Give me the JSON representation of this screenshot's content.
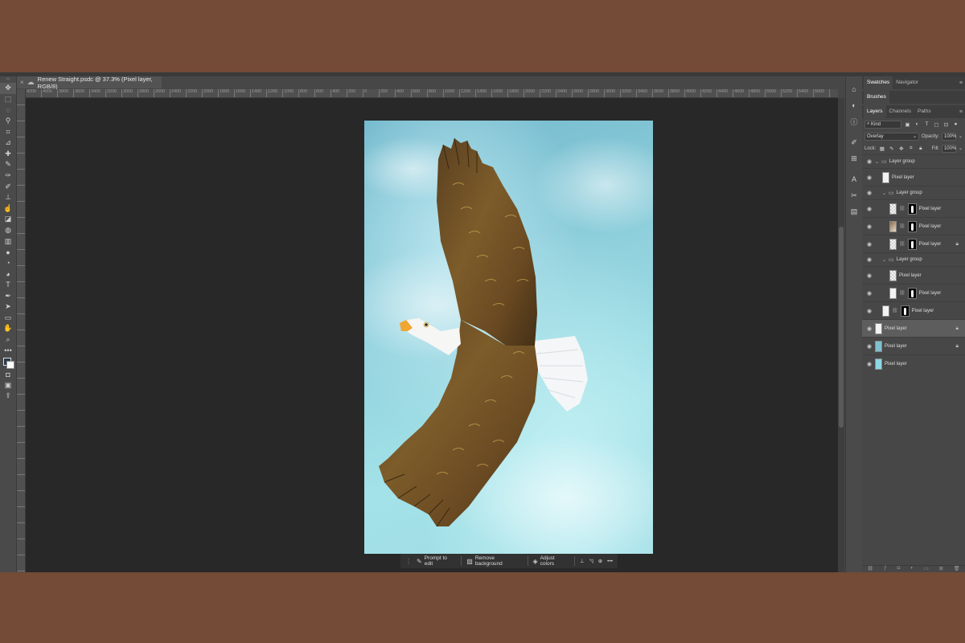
{
  "document": {
    "tab_title": "Renew Straight.psdc @ 37.3% (Pixel layer, RGB/8)"
  },
  "ruler": {
    "h_ticks": [
      "4200",
      "4000",
      "3800",
      "3600",
      "3400",
      "3200",
      "3000",
      "2800",
      "2600",
      "2400",
      "2200",
      "2000",
      "1800",
      "1600",
      "1400",
      "1200",
      "1000",
      "800",
      "600",
      "400",
      "200",
      "0",
      "200",
      "400",
      "600",
      "800",
      "1000",
      "1200",
      "1400",
      "1600",
      "1800",
      "2000",
      "2200",
      "2400",
      "2600",
      "2800",
      "3000",
      "3200",
      "3400",
      "3600",
      "3800",
      "4000",
      "4200",
      "4400",
      "4600",
      "4800",
      "5000",
      "5200",
      "5400",
      "5600"
    ]
  },
  "toolbar": {
    "tools": [
      "move-tool-icon",
      "marquee-tool-icon",
      "lasso-tool-icon",
      "object-select-tool-icon",
      "crop-tool-icon",
      "eyedropper-tool-icon",
      "spot-healing-tool-icon",
      "brush-tool-icon",
      "clone-stamp-tool-icon",
      "history-brush-tool-icon",
      "stamp-tool-icon",
      "smudge-tool-icon",
      "eraser-tool-icon",
      "paint-bucket-tool-icon",
      "gradient-tool-icon",
      "blur-tool-icon",
      "dodge-tool-icon",
      "sponge-tool-icon",
      "type-tool-icon",
      "pen-tool-icon",
      "path-select-tool-icon",
      "shape-tool-icon",
      "hand-tool-icon",
      "zoom-tool-icon",
      "more-tools-icon"
    ]
  },
  "contextual_taskbar": {
    "prompt": "Prompt to edit",
    "remove_bg": "Remove background",
    "adjust": "Adjust colors",
    "more": "•••"
  },
  "panels": {
    "top_tabs": [
      "Swatches",
      "Navigator"
    ],
    "mid_tabs": [
      "Brushes"
    ],
    "layer_tabs": [
      "Layers",
      "Channels",
      "Paths"
    ],
    "filter": "Kind",
    "blend_mode": "Overlay",
    "opacity_label": "Opacity:",
    "opacity_value": "100%",
    "lock_label": "Lock:",
    "fill_label": "Fill:",
    "fill_value": "100%"
  },
  "layers": [
    {
      "name": "Layer group",
      "type": "group",
      "indent": 0
    },
    {
      "name": "Pixel layer",
      "type": "pixel",
      "indent": 1,
      "thumb": "blank"
    },
    {
      "name": "Layer group",
      "type": "group",
      "indent": 1
    },
    {
      "name": "Pixel layer",
      "type": "pixel",
      "indent": 2,
      "thumb": "check",
      "mask": true
    },
    {
      "name": "Pixel layer",
      "type": "pixel",
      "indent": 2,
      "thumb": "feather",
      "mask": true
    },
    {
      "name": "Pixel layer",
      "type": "pixel",
      "indent": 2,
      "thumb": "check",
      "mask": true,
      "locked": true
    },
    {
      "name": "Layer group",
      "type": "group",
      "indent": 1
    },
    {
      "name": "Pixel layer",
      "type": "pixel",
      "indent": 2,
      "thumb": "check"
    },
    {
      "name": "Pixel layer",
      "type": "pixel",
      "indent": 2,
      "thumb": "blank",
      "mask": true
    },
    {
      "name": "Pixel layer",
      "type": "pixel",
      "indent": 1,
      "thumb": "blank",
      "mask": true
    },
    {
      "name": "Pixel layer",
      "type": "pixel",
      "indent": 0,
      "thumb": "blank",
      "selected": true,
      "locked": true
    },
    {
      "name": "Pixel layer",
      "type": "pixel",
      "indent": 0,
      "thumb": "sky",
      "locked": true
    },
    {
      "name": "Pixel layer",
      "type": "pixel",
      "indent": 0,
      "thumb": "cyan"
    }
  ],
  "colors": {
    "app_bg": "#474747",
    "canvas_bg": "#282828",
    "page_border": "#744b36",
    "sky": "#8fd0dc"
  }
}
